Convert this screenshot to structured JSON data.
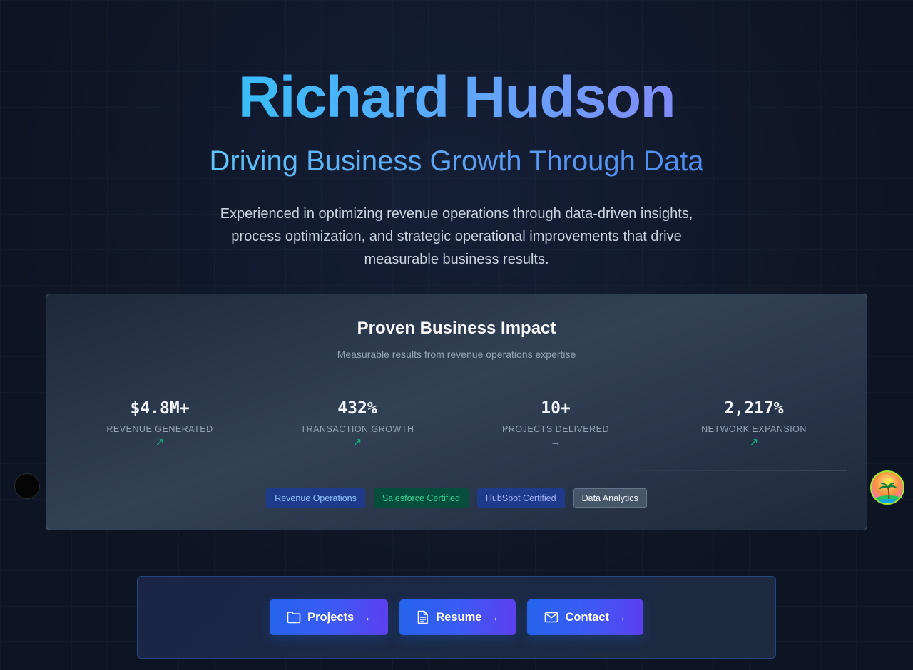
{
  "hero": {
    "name": "Richard Hudson",
    "tagline": "Driving Business Growth Through Data",
    "description": "Experienced in optimizing revenue operations through data-driven insights, process optimization, and strategic operational improvements that drive measurable business results."
  },
  "impact": {
    "title": "Proven Business Impact",
    "subtitle": "Measurable results from revenue operations expertise",
    "stats": [
      {
        "value": "$4.8M+",
        "label": "REVENUE GENERATED",
        "trend": "↗",
        "trend_type": "up"
      },
      {
        "value": "432%",
        "label": "TRANSACTION GROWTH",
        "trend": "↗",
        "trend_type": "up"
      },
      {
        "value": "10+",
        "label": "PROJECTS DELIVERED",
        "trend": "→",
        "trend_type": "flat"
      },
      {
        "value": "2,217%",
        "label": "NETWORK EXPANSION",
        "trend": "↗",
        "trend_type": "up"
      }
    ],
    "tags": [
      {
        "label": "Revenue Operations",
        "color": "#1e3a8a"
      },
      {
        "label": "Salesforce Certified",
        "color": "#064e3b"
      },
      {
        "label": "HubSpot Certified",
        "color": "#1e3a8a"
      },
      {
        "label": "Data Analytics",
        "color": "#475569"
      }
    ]
  },
  "cta": {
    "projects": {
      "label": "Projects",
      "icon": "folder-icon",
      "arrow": "→"
    },
    "resume": {
      "label": "Resume",
      "icon": "document-icon",
      "arrow": "→"
    },
    "contact": {
      "label": "Contact",
      "icon": "mail-icon",
      "arrow": "→"
    }
  },
  "colors": {
    "background": "#0f172a",
    "accent": "#2563eb",
    "trend_up": "#10b981"
  }
}
